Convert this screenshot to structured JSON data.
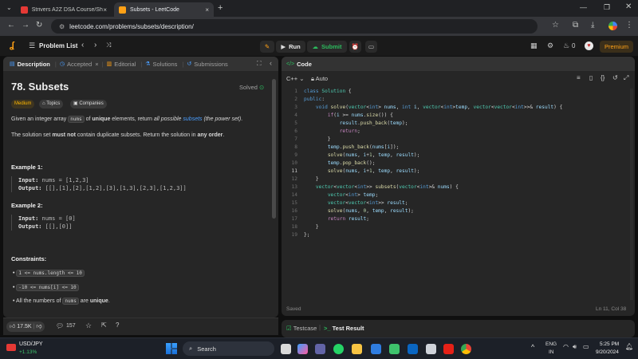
{
  "browser": {
    "tabs": [
      {
        "title": "Strivers A2Z DSA Course/Sheet",
        "favicon_color": "#e53935"
      },
      {
        "title": "Subsets - LeetCode",
        "favicon_color": "#ffa116"
      }
    ],
    "url": "leetcode.com/problems/subsets/description/"
  },
  "header": {
    "problem_list": "Problem List",
    "run": "Run",
    "submit": "Submit",
    "streak": "0",
    "premium": "Premium"
  },
  "left": {
    "tabs": [
      "Description",
      "Accepted",
      "Editorial",
      "Solutions",
      "Submissions"
    ],
    "title": "78. Subsets",
    "status": "Solved",
    "difficulty": "Medium",
    "topics": "Topics",
    "companies": "Companies",
    "desc1_a": "Given an integer array ",
    "desc1_code": "nums",
    "desc1_b": " of ",
    "desc1_bold": "unique",
    "desc1_c": " elements, return ",
    "desc1_ital": "all possible",
    "desc1_link": "subsets",
    "desc1_ital2": "(the power set)",
    "desc1_d": ".",
    "desc2_a": "The solution set ",
    "desc2_bold": "must not",
    "desc2_b": " contain duplicate subsets. Return the solution in ",
    "desc2_bold2": "any order",
    "desc2_c": ".",
    "ex1_title": "Example 1:",
    "ex1_input_label": "Input:",
    "ex1_input": "nums = [1,2,3]",
    "ex1_output_label": "Output:",
    "ex1_output": "[[],[1],[2],[1,2],[3],[1,3],[2,3],[1,2,3]]",
    "ex2_title": "Example 2:",
    "ex2_input_label": "Input:",
    "ex2_input": "nums = [0]",
    "ex2_output_label": "Output:",
    "ex2_output": "[[],[0]]",
    "constraints_title": "Constraints:",
    "c1": "1 <= nums.length <= 10",
    "c2": "-10 <= nums[i] <= 10",
    "c3_a": "All the numbers of ",
    "c3_code": "nums",
    "c3_b": " are ",
    "c3_bold": "unique",
    "c3_c": ".",
    "likes": "17.5K",
    "comments": "157"
  },
  "editor": {
    "title": "Code",
    "language": "C++",
    "auto": "Auto",
    "saved": "Saved",
    "cursor": "Ln 11, Col 38",
    "lines": [
      "1",
      "2",
      "3",
      "4",
      "5",
      "6",
      "7",
      "8",
      "9",
      "10",
      "11",
      "12",
      "13",
      "14",
      "15",
      "16",
      "17",
      "18",
      "19"
    ]
  },
  "bottom": {
    "testcase": "Testcase",
    "result": "Test Result"
  },
  "taskbar": {
    "ticker": "USD/JPY",
    "change": "+1.13%",
    "search": "Search",
    "lang1": "ENG",
    "lang2": "IN",
    "time": "5:25 PM",
    "date": "9/20/2024"
  }
}
